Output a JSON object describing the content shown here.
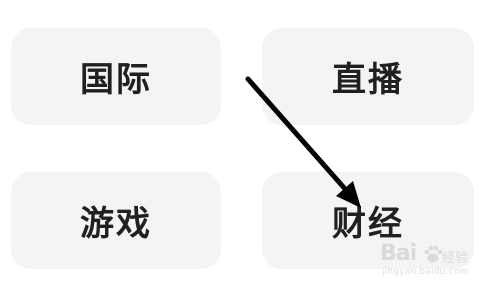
{
  "tiles": {
    "guoji": {
      "label": "国际"
    },
    "zhibo": {
      "label": "直播"
    },
    "youxi": {
      "label": "游戏"
    },
    "caijing": {
      "label": "财经"
    }
  },
  "annotation": {
    "arrow_color": "#000000",
    "arrow_target": "caijing"
  },
  "watermark": {
    "brand": "Bai",
    "brand_suffix": "经验",
    "url": "jingyan.baidu.com",
    "icon": "baidu-paw-icon"
  },
  "colors": {
    "tile_bg": "#f4f4f4",
    "label": "#202020",
    "page_bg": "#ffffff"
  }
}
